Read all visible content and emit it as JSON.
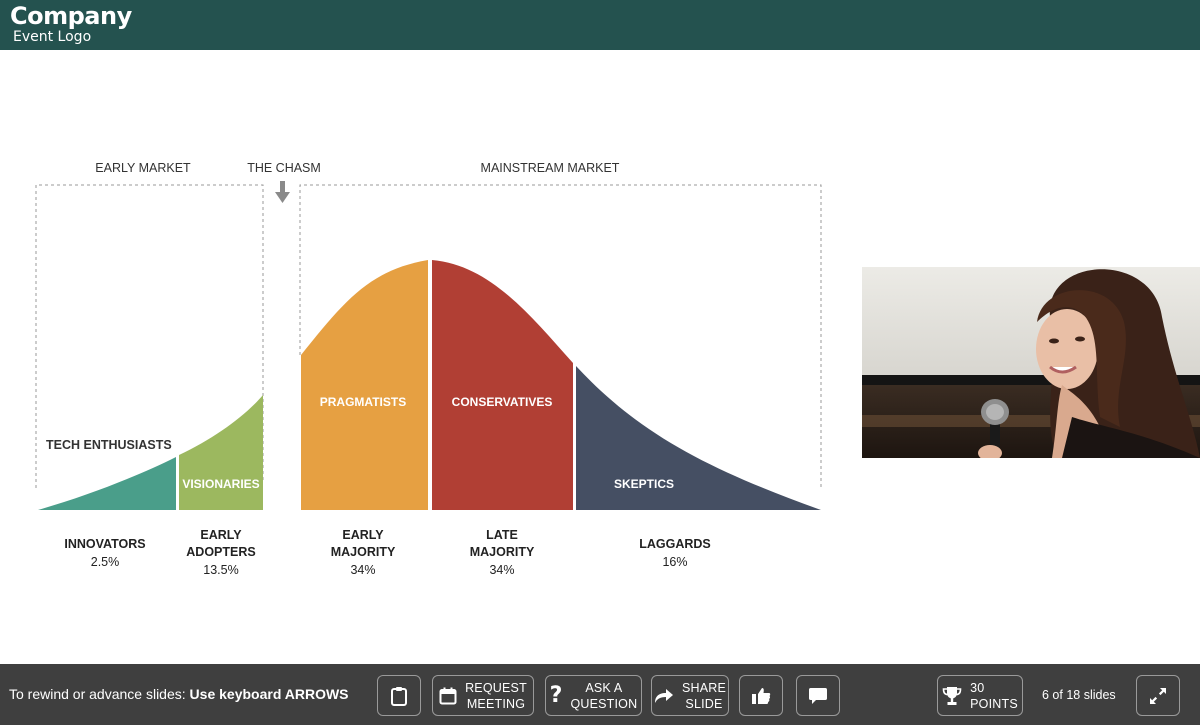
{
  "header": {
    "company": "Company",
    "event_logo": "Event Logo"
  },
  "slide": {
    "sections": {
      "early_market": "EARLY MARKET",
      "chasm": "THE CHASM",
      "mainstream_market": "MAINSTREAM MARKET"
    },
    "segment_labels": {
      "tech_enthusiasts": "TECH ENTHUSIASTS",
      "visionaries": "VISIONARIES",
      "pragmatists": "PRAGMATISTS",
      "conservatives": "CONSERVATIVES",
      "skeptics": "SKEPTICS"
    },
    "groups": [
      {
        "line1": "INNOVATORS",
        "line2": "",
        "share": "2.5%"
      },
      {
        "line1": "EARLY",
        "line2": "ADOPTERS",
        "share": "13.5%"
      },
      {
        "line1": "EARLY",
        "line2": "MAJORITY",
        "share": "34%"
      },
      {
        "line1": "LATE",
        "line2": "MAJORITY",
        "share": "34%"
      },
      {
        "line1": "LAGGARDS",
        "line2": "",
        "share": "16%"
      }
    ],
    "colors": {
      "innovators": "#4a9e8a",
      "early_adopters": "#9cb85f",
      "early_majority": "#e6a042",
      "late_majority": "#b13f34",
      "laggards": "#454f63"
    }
  },
  "bottombar": {
    "hint_prefix": "To rewind or advance slides: ",
    "hint_bold": "Use keyboard ARROWS",
    "request_meeting": {
      "line1": "REQUEST",
      "line2": "MEETING"
    },
    "ask_question": {
      "line1": "ASK A",
      "line2": "QUESTION"
    },
    "share_slide": {
      "line1": "SHARE",
      "line2": "SLIDE"
    },
    "points": {
      "line1": "30",
      "line2": "POINTS"
    },
    "slide_counter": "6 of 18 slides",
    "icons": {
      "notes": "clipboard-icon",
      "meeting": "calendar-icon",
      "question": "question-mark-icon",
      "share": "share-arrow-icon",
      "like": "thumbs-up-icon",
      "chat": "chat-bubble-icon",
      "points": "trophy-icon",
      "fullscreen": "expand-icon"
    }
  }
}
